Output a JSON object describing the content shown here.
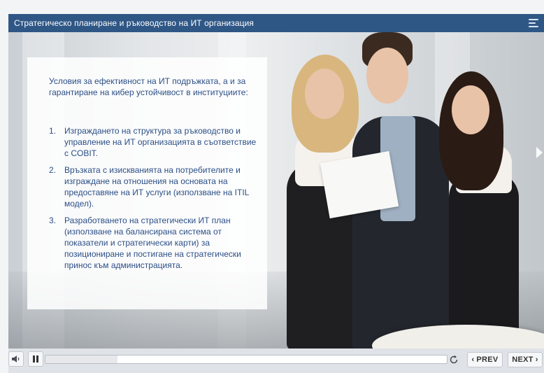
{
  "header": {
    "title": "Стратегическо планиране и ръководство на ИТ организация",
    "menu_icon": "menu-icon"
  },
  "slide": {
    "intro": "Условия за ефективност на ИТ подръжката, а и за гарантиране на кибер устойчивост в институциите:",
    "items": [
      {
        "num": "1.",
        "text": "Изграждането на структура за ръководство и управление на ИТ организацията в съответствие с COBIT."
      },
      {
        "num": "2.",
        "text": "Връзката с изискванията на потребителите и изграждане на отношения на основата на предоставяне на ИТ услуги (използване на ITIL модел)."
      },
      {
        "num": "3.",
        "text": "Разработването на стратегически ИТ план (използване на балансирана система от показатели и стратегически карти) за позициониране и постигане на стратегически принос към администрацията."
      }
    ]
  },
  "controls": {
    "progress": 0.18,
    "prev_label": "PREV",
    "next_label": "NEXT",
    "icons": [
      "volume-icon",
      "pause-icon",
      "replay-icon",
      "chevron-left-icon",
      "chevron-right-icon"
    ]
  },
  "colors": {
    "header_bg": "#2f5786",
    "text": "#2b4f86"
  }
}
